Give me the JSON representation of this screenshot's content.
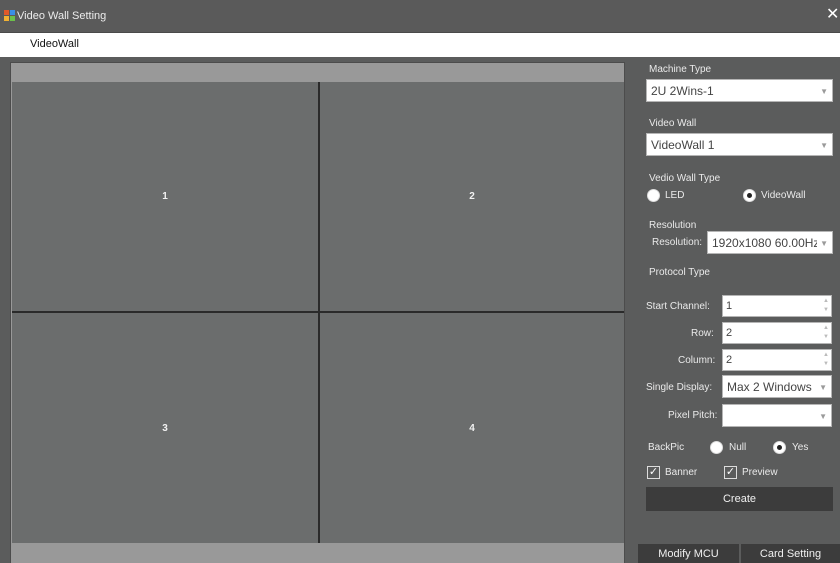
{
  "window": {
    "title": "Video Wall Setting",
    "close_glyph": "✕"
  },
  "menu": {
    "items": [
      {
        "label": "VideoWall"
      }
    ]
  },
  "wall": {
    "cells": [
      "1",
      "2",
      "3",
      "4"
    ]
  },
  "panel": {
    "machine_type": {
      "label": "Machine Type",
      "value": "2U 2Wins-1"
    },
    "video_wall": {
      "label": "Video Wall",
      "value": "VideoWall 1"
    },
    "wall_type": {
      "label": "Vedio Wall Type",
      "options": [
        "LED",
        "VideoWall"
      ],
      "selected": "VideoWall"
    },
    "resolution": {
      "section_label": "Resolution",
      "label": "Resolution:",
      "value": "1920x1080 60.00Hz"
    },
    "protocol_type": {
      "label": "Protocol Type"
    },
    "start_channel": {
      "label": "Start Channel:",
      "value": "1"
    },
    "row": {
      "label": "Row:",
      "value": "2"
    },
    "column": {
      "label": "Column:",
      "value": "2"
    },
    "single_display": {
      "label": "Single Display:",
      "value": "Max 2 Windows"
    },
    "pixel_pitch": {
      "label": "Pixel Pitch:",
      "value": ""
    },
    "backpic": {
      "label": "BackPic",
      "options": [
        "Null",
        "Yes"
      ],
      "selected": "Yes"
    },
    "banner": {
      "label": "Banner",
      "checked": true
    },
    "preview": {
      "label": "Preview",
      "checked": true
    },
    "create_label": "Create",
    "modify_mcu_label": "Modify MCU",
    "card_setting_label": "Card Setting"
  },
  "icons": {
    "title": "app-icon",
    "close": "close-icon",
    "dropdown": "chevron-down-icon",
    "spinner": "spinner-arrows-icon"
  }
}
